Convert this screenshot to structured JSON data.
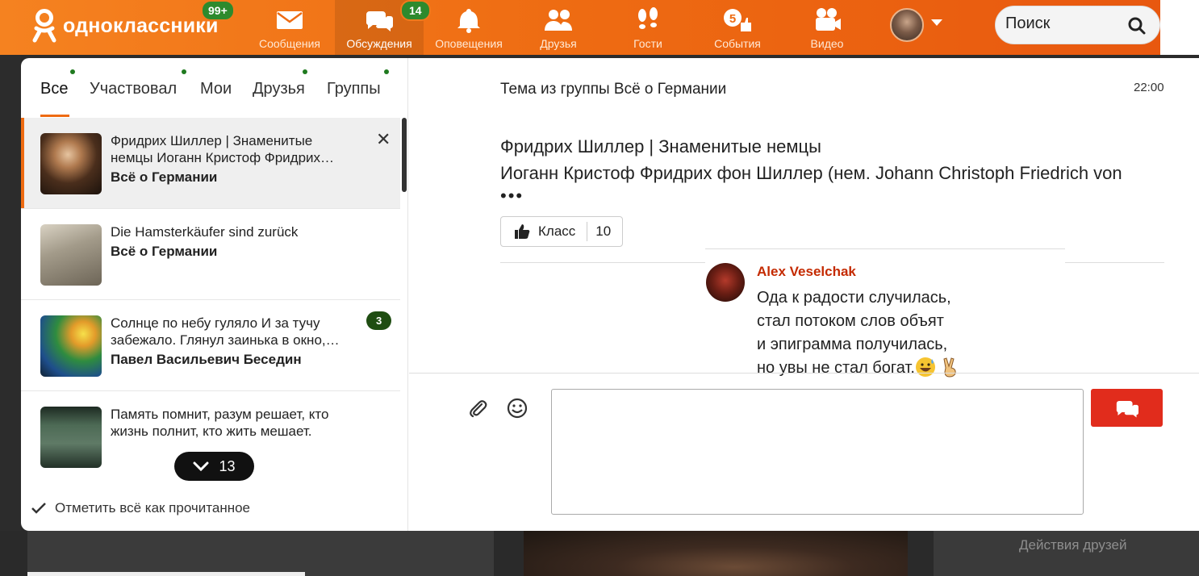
{
  "header": {
    "logo_text": "одноклассники",
    "logo_badge": "99+",
    "nav": [
      {
        "label": "Сообщения",
        "icon": "envelope-icon"
      },
      {
        "label": "Обсуждения",
        "icon": "discussions-icon",
        "badge": "14",
        "active": true
      },
      {
        "label": "Оповещения",
        "icon": "bell-icon"
      },
      {
        "label": "Друзья",
        "icon": "friends-icon"
      },
      {
        "label": "Гости",
        "icon": "footprints-icon"
      },
      {
        "label": "События",
        "icon": "events-icon"
      },
      {
        "label": "Видео",
        "icon": "video-camera-icon"
      }
    ],
    "search_placeholder": "Поиск",
    "colors": {
      "bar": "#ee6b12",
      "badge": "#2d8a2d"
    }
  },
  "discussions": {
    "tabs": [
      "Все",
      "Участвовал",
      "Мои",
      "Друзья",
      "Группы"
    ],
    "active_tab": "Все",
    "items": [
      {
        "title": "Фридрих Шиллер | Знаменитые немцы Иоганн Кристоф Фридрих…",
        "subtitle": "Всё о Германии",
        "selected": true
      },
      {
        "title": "Die Hamsterkäufer sind zurück",
        "subtitle": "Всё о Германии"
      },
      {
        "title": "Солнце по небу гуляло И за тучу забежало. Глянул заинька в окно,…",
        "subtitle": "Павел Васильевич Беседин",
        "count": "3"
      },
      {
        "title": "Память помнит, разум решает, кто жизнь полнит, кто жить мешает.",
        "subtitle": ""
      }
    ],
    "more_count": "13",
    "mark_all_read": "Отметить всё как прочитанное"
  },
  "thread": {
    "heading": "Тема из группы Всё о Германии",
    "time": "22:00",
    "post_title": "Фридрих Шиллер | Знаменитые немцы",
    "post_body": "Иоганн Кристоф Фридрих фон Шиллер (нем. Johann Christoph Friedrich von",
    "ellipsis": "•••",
    "like_label": "Класс",
    "like_count": "10",
    "comment": {
      "author": "Alex Veselchak",
      "lines": [
        "Ода к радости случилась,",
        "стал потоком слов объят",
        "и эпиграмма получилась,",
        "но увы не стал богат."
      ]
    }
  },
  "background": {
    "friends_actions": "Действия друзей"
  }
}
